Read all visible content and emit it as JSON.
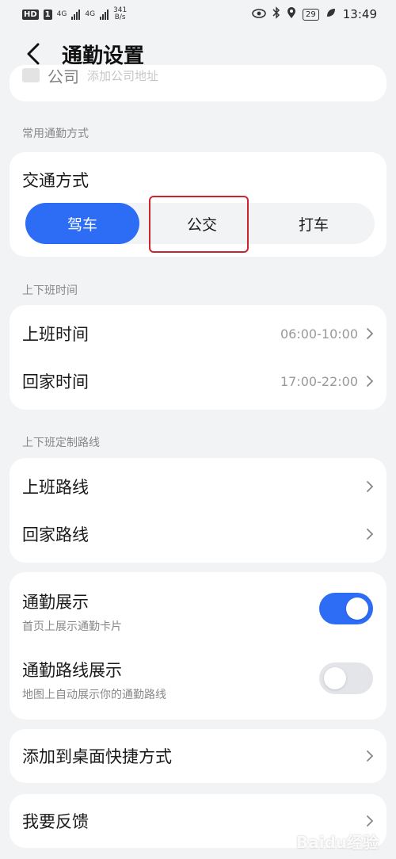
{
  "status_bar": {
    "hd_label": "HD",
    "sim1_label": "1",
    "net_speed_value": "341",
    "net_speed_unit": "B/s",
    "network_type": "4G",
    "battery": "29",
    "time": "13:49"
  },
  "header": {
    "title": "通勤设置"
  },
  "top_card": {
    "partial_row_title": "公司",
    "partial_row_hint": "添加公司地址"
  },
  "commute_mode": {
    "section_label": "常用通勤方式",
    "title": "交通方式",
    "options": [
      "驾车",
      "公交",
      "打车"
    ],
    "selected": "驾车"
  },
  "work_time": {
    "section_label": "上下班时间",
    "rows": [
      {
        "title": "上班时间",
        "value": "06:00-10:00"
      },
      {
        "title": "回家时间",
        "value": "17:00-22:00"
      }
    ]
  },
  "routes": {
    "section_label": "上下班定制路线",
    "rows": [
      {
        "title": "上班路线"
      },
      {
        "title": "回家路线"
      }
    ]
  },
  "display": {
    "rows": [
      {
        "title": "通勤展示",
        "subtitle": "首页上展示通勤卡片",
        "enabled": true
      },
      {
        "title": "通勤路线展示",
        "subtitle": "地图上自动展示你的通勤路线",
        "enabled": false
      }
    ]
  },
  "shortcut": {
    "title": "添加到桌面快捷方式"
  },
  "feedback": {
    "title": "我要反馈"
  },
  "watermark": "Baidu经验",
  "colors": {
    "accent": "#2d6df6",
    "highlight": "#c9262c",
    "background": "#f1f3f5"
  }
}
